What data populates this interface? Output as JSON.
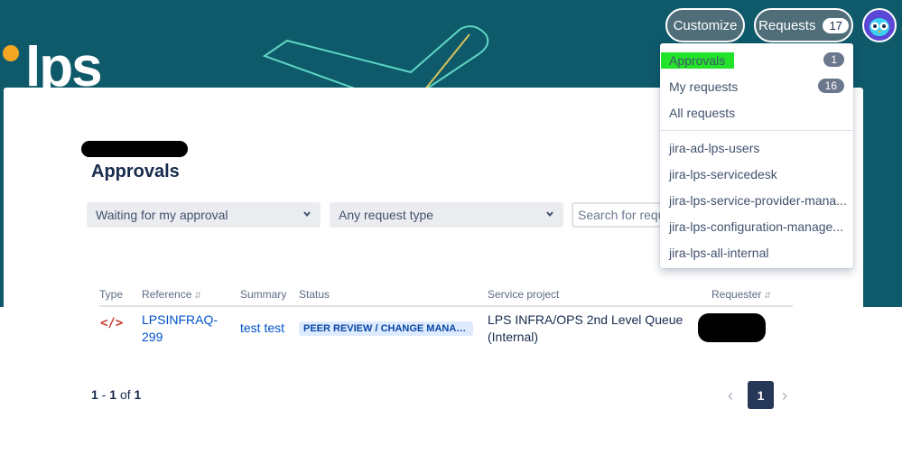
{
  "header": {
    "logo_text": "lps",
    "customize_label": "Customize",
    "requests_label": "Requests",
    "requests_count": "17",
    "avatar_icon": "owl-avatar-icon"
  },
  "requests_menu": {
    "items": [
      {
        "label": "Approvals",
        "count": "1",
        "highlight_color": "#22e32a"
      },
      {
        "label": "My requests",
        "count": "16"
      },
      {
        "label": "All requests",
        "count": ""
      }
    ],
    "groups": [
      {
        "label": "jira-ad-lps-users"
      },
      {
        "label": "jira-lps-servicedesk"
      },
      {
        "label": "jira-lps-service-provider-mana..."
      },
      {
        "label": "jira-lps-configuration-manage..."
      },
      {
        "label": "jira-lps-all-internal"
      }
    ]
  },
  "main": {
    "title": "Approvals",
    "filters": {
      "approval_filter": "Waiting for my approval",
      "request_type_filter": "Any request type",
      "search_placeholder": "Search for reque"
    },
    "table": {
      "columns": [
        "Type",
        "Reference",
        "Summary",
        "Status",
        "Service project",
        "Requester"
      ],
      "rows": [
        {
          "type_icon": "code-icon",
          "reference": "LPSINFRAQ-299",
          "summary": "test test",
          "status": "PEER REVIEW / CHANGE MANAGE...",
          "service_project": "LPS INFRA/OPS 2nd Level Queue (Internal)"
        }
      ]
    },
    "pagination": {
      "from": "1",
      "to": "1",
      "of_label": "of",
      "total": "1",
      "current_page": "1"
    }
  },
  "colors": {
    "banner": "#0e5a6b",
    "link": "#0052cc",
    "status_bg": "#deebff",
    "accent_orange": "#f5a623"
  }
}
